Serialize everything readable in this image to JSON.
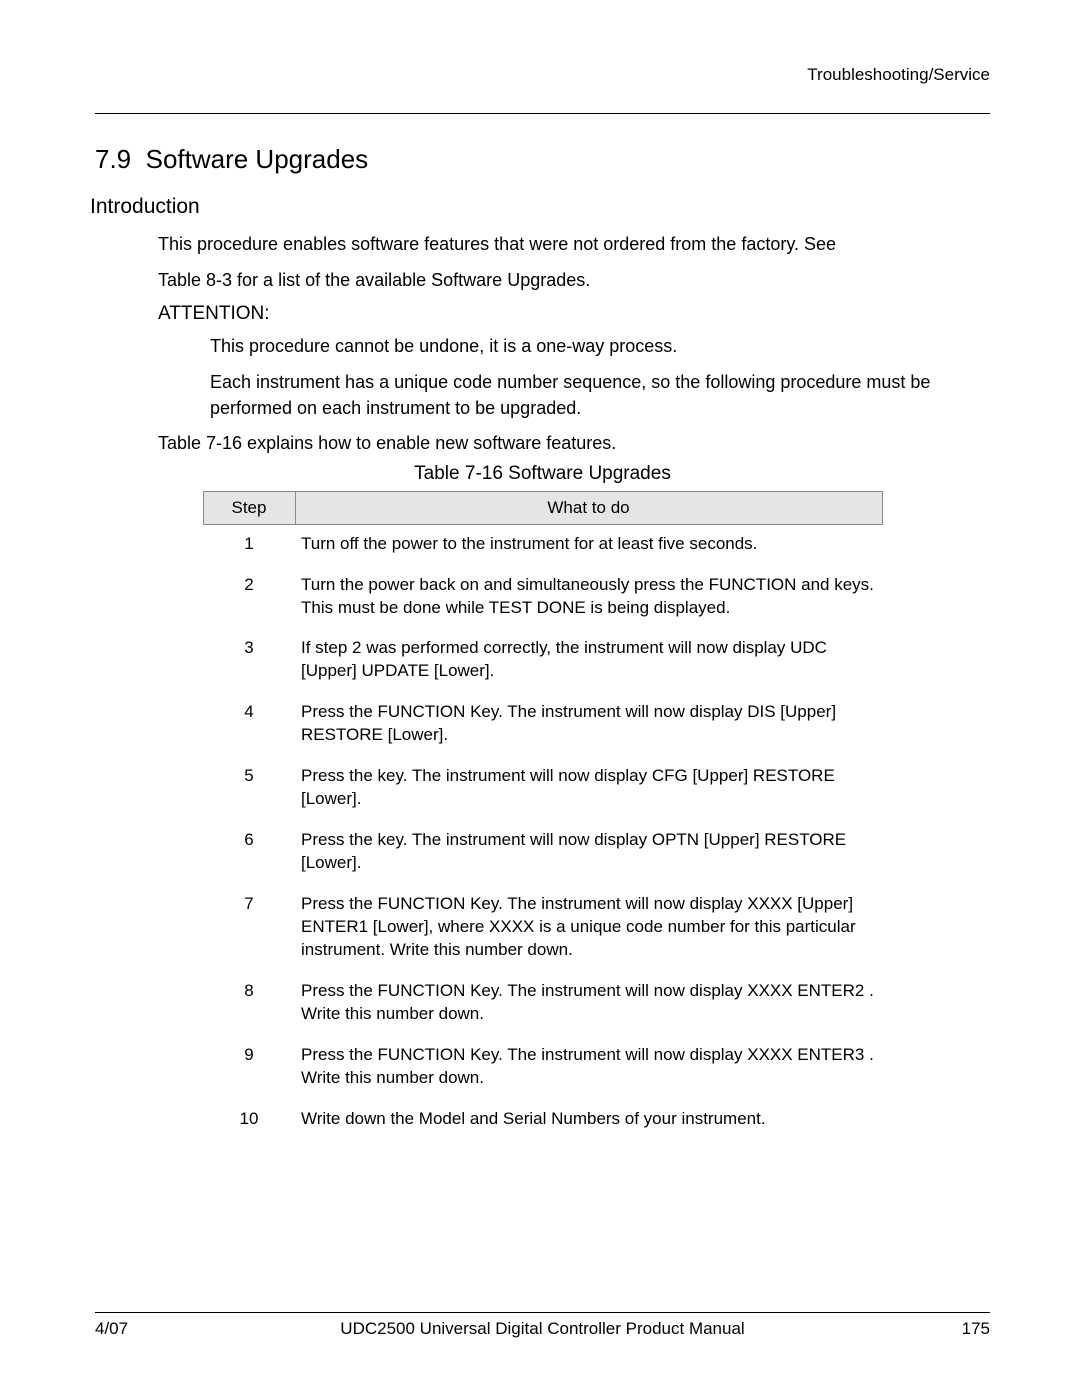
{
  "header": {
    "section": "Troubleshooting/Service"
  },
  "title": {
    "num": "7.9",
    "text": "Software Upgrades"
  },
  "intro": {
    "heading": "Introduction",
    "para1": "This procedure enables software features that were not ordered from the factory.  See",
    "para2": "Table 8-3 for a list of the available Software Upgrades.",
    "attention": "ATTENTION:",
    "attn1": "This procedure cannot be undone, it is a one-way process.",
    "attn2": "Each instrument has a unique code number sequence, so the following procedure must be performed on each instrument to be upgraded.",
    "ref": "Table 7-16 explains how to enable new software features."
  },
  "table": {
    "caption": "Table 7-16  Software Upgrades",
    "headers": {
      "step": "Step",
      "what": "What to do"
    },
    "rows": [
      {
        "n": "1",
        "t": "Turn off the power to the instrument for at least five seconds."
      },
      {
        "n": "2",
        "t": "Turn the power back on and simultaneously press the FUNCTION and    keys.  This must be done while  TEST DONE  is being displayed."
      },
      {
        "n": "3",
        "t": "If step 2 was performed correctly, the instrument will now display  UDC  [Upper]  UPDATE  [Lower]."
      },
      {
        "n": "4",
        "t": "Press the FUNCTION Key.  The instrument will now display  DIS  [Upper]  RESTORE  [Lower]."
      },
      {
        "n": "5",
        "t": "Press the        key.  The instrument will now display  CFG  [Upper]  RESTORE  [Lower]."
      },
      {
        "n": "6",
        "t": "Press the        key.  The instrument will now display  OPTN  [Upper]  RESTORE  [Lower]."
      },
      {
        "n": "7",
        "t": "Press the FUNCTION Key.  The instrument will now display  XXXX  [Upper]  ENTER1  [Lower], where XXXX is a unique code number for this particular instrument.  Write this number down."
      },
      {
        "n": "8",
        "t": "Press the FUNCTION Key.  The instrument will now display  XXXX   ENTER2 .  Write this number down."
      },
      {
        "n": "9",
        "t": "Press the FUNCTION Key.  The instrument will now display  XXXX   ENTER3 .  Write this number down."
      },
      {
        "n": "10",
        "t": "Write down the Model and Serial Numbers of your instrument."
      }
    ]
  },
  "footer": {
    "left": "4/07",
    "center": "UDC2500 Universal Digital   Controller Product Manual",
    "right": "175"
  }
}
